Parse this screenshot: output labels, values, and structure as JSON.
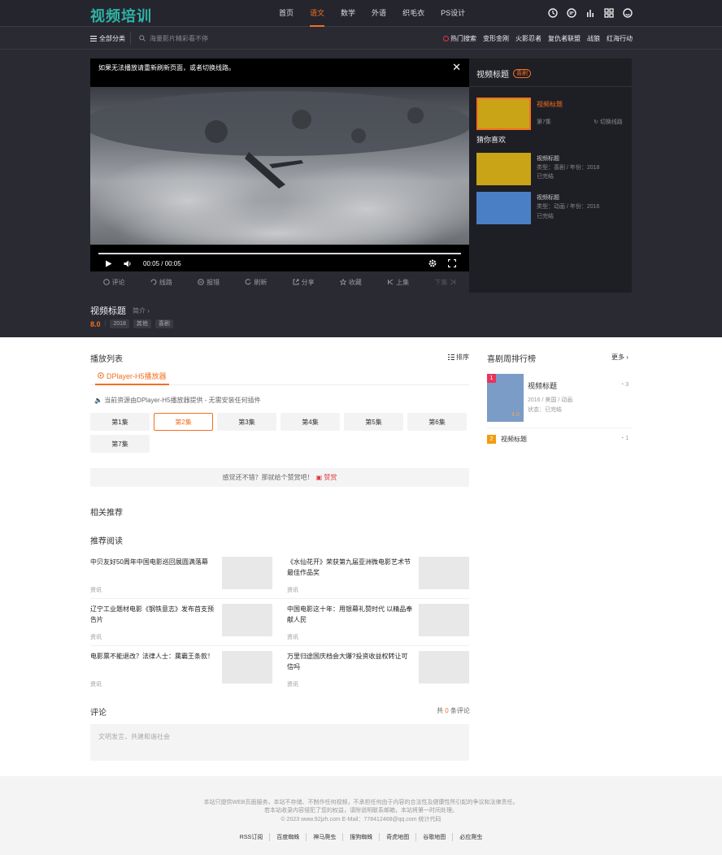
{
  "header": {
    "logo": "视频培训",
    "nav": [
      "首页",
      "语文",
      "数学",
      "外语",
      "织毛衣",
      "PS设计"
    ],
    "active_nav": 1
  },
  "subnav": {
    "all_categories": "全部分类",
    "search_placeholder": "海量影片精彩看不停",
    "hot_search": "热门搜索",
    "hot_links": [
      "变形金刚",
      "火影忍者",
      "复仇者联盟",
      "战狼",
      "红海行动"
    ]
  },
  "player": {
    "tip": "如果无法播放请重新刷新页面，或者切换线路。",
    "time": "00:05 / 00:05"
  },
  "actions": [
    "评论",
    "线路",
    "报错",
    "刷新",
    "分享",
    "收藏",
    "上集",
    "下集"
  ],
  "right_panel": {
    "title": "视频标题",
    "badge": "喜剧",
    "current_title": "视频标题",
    "current_episode": "第7集",
    "switch_line": "切换线路",
    "guess_title": "猜你喜欢",
    "guess": [
      {
        "title": "视频标题",
        "meta": "类型：喜剧 / 年份：2018",
        "status": "已完结",
        "color": "#c8a416"
      },
      {
        "title": "视频标题",
        "meta": "类型：动画 / 年份：2016",
        "status": "已完结",
        "color": "#4a7fc5"
      }
    ]
  },
  "video_info": {
    "title": "视频标题",
    "intro": "简介",
    "score": "8.0",
    "tags": [
      "2018",
      "其他",
      "喜剧"
    ]
  },
  "playlist": {
    "title": "播放列表",
    "sort": "排序",
    "source": "DPlayer-H5播放器",
    "source_info": "当前资源由DPlayer-H5播放器提供 - 无需安装任何插件",
    "episodes": [
      "第1集",
      "第2集",
      "第3集",
      "第4集",
      "第5集",
      "第6集",
      "第7集"
    ],
    "active_episode": 1,
    "tip": "感觉还不错？那就给个赞赏吧！",
    "tip_link": "赞赏"
  },
  "related_title": "相关推荐",
  "reading": {
    "title": "推荐阅读",
    "articles": [
      {
        "title": "中贝友好50周年中国电影巡回展圆满落幕",
        "cat": "资讯"
      },
      {
        "title": "《水仙花开》荣获第九届亚洲微电影艺术节最佳作品奖",
        "cat": "资讯"
      },
      {
        "title": "辽宁工业题材电影《钢铁意志》发布首支预告片",
        "cat": "资讯"
      },
      {
        "title": "中国电影这十年：用银幕礼赞时代 以精品奉献人民",
        "cat": "资讯"
      },
      {
        "title": "电影票不能退改？法律人士：属霸王条款！",
        "cat": "资讯"
      },
      {
        "title": "万里归途国庆档会大爆?投资收益权转让可信吗",
        "cat": "资讯"
      }
    ]
  },
  "comments": {
    "title": "评论",
    "count_prefix": "共",
    "count": "0",
    "count_suffix": "条评论",
    "placeholder": "文明发言，共建和谐社会"
  },
  "ranking": {
    "title": "喜剧周排行榜",
    "more": "更多",
    "items": [
      {
        "rank": "1",
        "title": "视频标题",
        "meta": "2016 / 美国 / 动画",
        "status": "状态：已完结",
        "score": "4.0",
        "heat": "3"
      },
      {
        "rank": "2",
        "title": "视频标题",
        "heat": "1"
      }
    ]
  },
  "footer": {
    "line1": "本站只提供WEB页面服务，本站不存储、不制作任何视频，不承担任何由于内容的合法性及健康性所引起的争议和法律责任。",
    "line2": "若本站收录内容侵犯了您的权益，请附说明联系邮箱，本站将第一时间处理。",
    "line3": "© 2023 www.92jzh.com  E-Mail：778412468@qq.com  统计代码",
    "links": [
      "RSS订阅",
      "百度蜘蛛",
      "神马爬虫",
      "搜狗蜘蛛",
      "奇虎地图",
      "谷歌地图",
      "必应爬虫"
    ]
  }
}
